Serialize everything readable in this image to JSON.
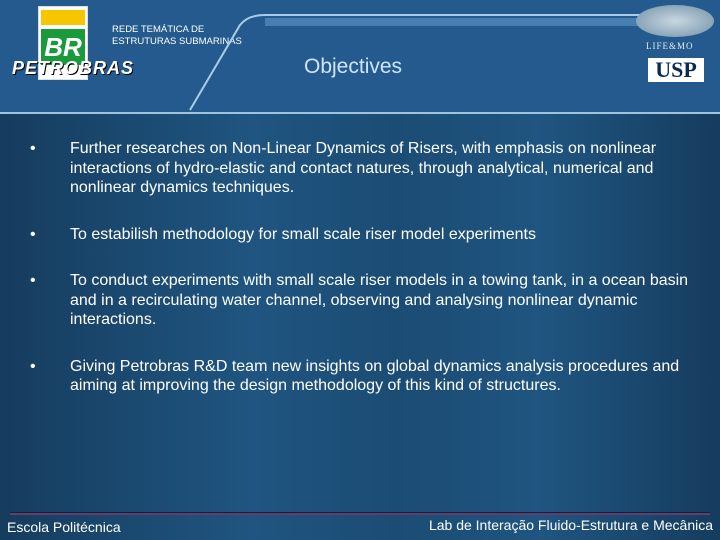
{
  "header": {
    "petrobras_logo": "BR",
    "petrobras_name": "PETROBRAS",
    "network_line1": "REDE TEMÁTICA DE",
    "network_line2": "ESTRUTURAS SUBMARINAS",
    "title": "Objectives",
    "lifemo_label": "LIFE&MO",
    "usp_logo": "USP"
  },
  "bullets": [
    {
      "text": "Further researches on Non-Linear Dynamics of Risers, with emphasis on nonlinear interactions of hydro-elastic  and contact natures, through analytical, numerical and nonlinear dynamics techniques."
    },
    {
      "text": "To estabilish methodology for small scale riser model experiments"
    },
    {
      "text": "To conduct experiments with small scale riser models in a towing tank, in a ocean basin and in a recirculating water channel, observing and analysing nonlinear dynamic interactions."
    },
    {
      "text": "Giving Petrobras R&D team new insights on global dynamics analysis procedures and aiming at improving the design methodology  of this kind of structures."
    }
  ],
  "bullet_glyph": "•",
  "footer": {
    "left": "Escola Politécnica",
    "right": "Lab de Interação Fluido-Estrutura e Mecânica"
  }
}
